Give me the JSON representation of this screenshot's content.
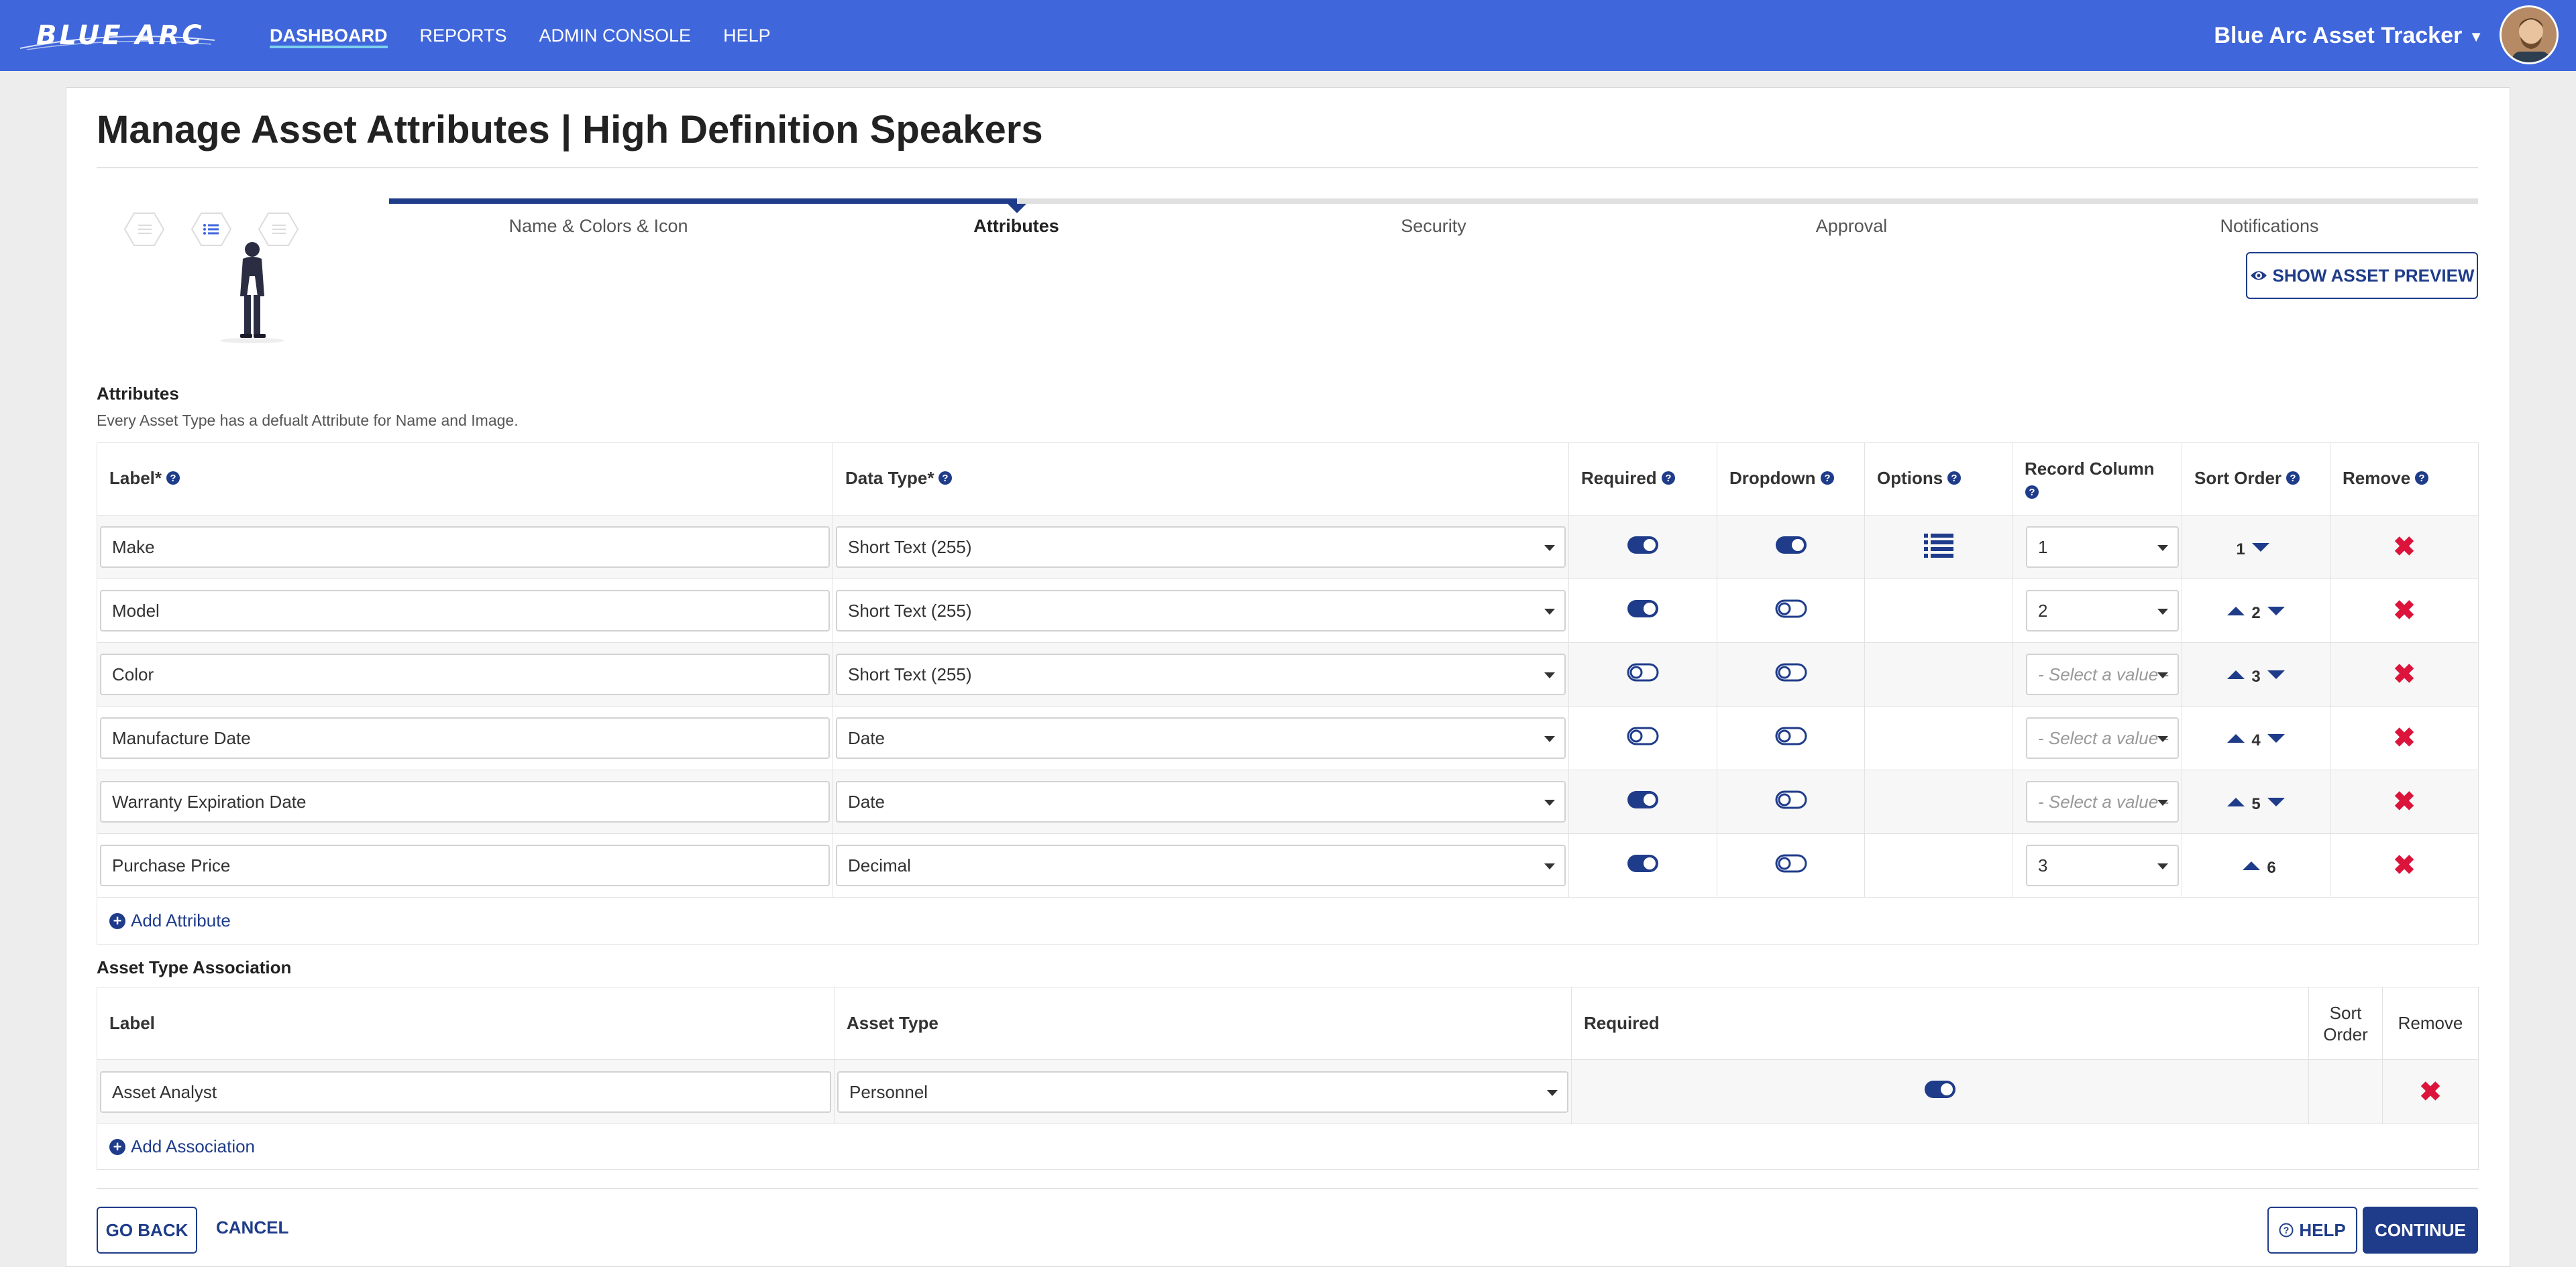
{
  "nav": {
    "logo_text": "BLUE ARC",
    "items": [
      {
        "label": "DASHBOARD",
        "active": true
      },
      {
        "label": "REPORTS",
        "active": false
      },
      {
        "label": "ADMIN CONSOLE",
        "active": false
      },
      {
        "label": "HELP",
        "active": false
      }
    ],
    "app_name": "Blue Arc Asset Tracker"
  },
  "page": {
    "title": "Manage Asset Attributes | High Definition Speakers"
  },
  "stepper": {
    "steps": [
      "Name & Colors & Icon",
      "Attributes",
      "Security",
      "Approval",
      "Notifications"
    ],
    "active_index": 1
  },
  "preview_button": "SHOW ASSET PREVIEW",
  "attributes": {
    "title": "Attributes",
    "subtitle": "Every Asset Type has a defualt Attribute for Name and Image.",
    "headers": {
      "label": "Label*",
      "data_type": "Data Type*",
      "required": "Required",
      "dropdown": "Dropdown",
      "options": "Options",
      "record_column": "Record Column",
      "sort_order": "Sort Order",
      "remove": "Remove"
    },
    "rows": [
      {
        "label": "Make",
        "data_type": "Short Text (255)",
        "required": true,
        "dropdown": true,
        "has_options": true,
        "record_column": "1",
        "sort": "1",
        "up": false,
        "down": true
      },
      {
        "label": "Model",
        "data_type": "Short Text (255)",
        "required": true,
        "dropdown": false,
        "has_options": false,
        "record_column": "2",
        "sort": "2",
        "up": true,
        "down": true
      },
      {
        "label": "Color",
        "data_type": "Short Text (255)",
        "required": false,
        "dropdown": false,
        "has_options": false,
        "record_column": "- Select a value -",
        "sort": "3",
        "up": true,
        "down": true
      },
      {
        "label": "Manufacture Date",
        "data_type": "Date",
        "required": false,
        "dropdown": false,
        "has_options": false,
        "record_column": "- Select a value -",
        "sort": "4",
        "up": true,
        "down": true
      },
      {
        "label": "Warranty Expiration Date",
        "data_type": "Date",
        "required": true,
        "dropdown": false,
        "has_options": false,
        "record_column": "- Select a value -",
        "sort": "5",
        "up": true,
        "down": true
      },
      {
        "label": "Purchase Price",
        "data_type": "Decimal",
        "required": true,
        "dropdown": false,
        "has_options": false,
        "record_column": "3",
        "sort": "6",
        "up": true,
        "down": false
      }
    ],
    "add_label": "Add Attribute",
    "remove_glyph": "✖"
  },
  "association": {
    "title": "Asset Type Association",
    "headers": {
      "label": "Label",
      "asset_type": "Asset Type",
      "required": "Required",
      "sort_order_1": "Sort",
      "sort_order_2": "Order",
      "remove": "Remove"
    },
    "rows": [
      {
        "label": "Asset Analyst",
        "asset_type": "Personnel",
        "required": true
      }
    ],
    "add_label": "Add Association"
  },
  "footer": {
    "go_back": "GO BACK",
    "cancel": "CANCEL",
    "help": "HELP",
    "continue": "CONTINUE"
  },
  "colors": {
    "navbar": "#3f66db",
    "primary": "#1f3c8a",
    "remove": "#dc143c"
  }
}
